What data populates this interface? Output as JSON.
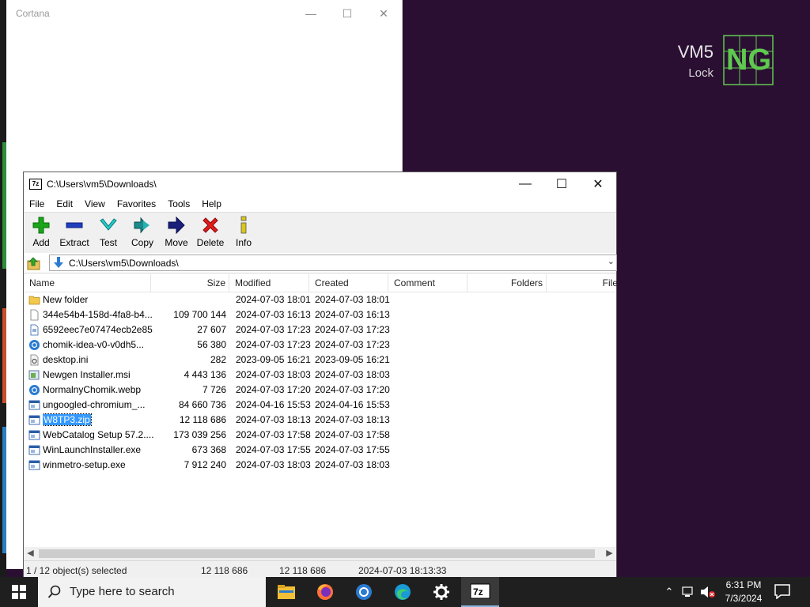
{
  "vm": {
    "name": "VM5",
    "sub": "Lock",
    "logo_text": "NG",
    "accent": "#5fc94f"
  },
  "cortana": {
    "title": "Cortana",
    "controls": {
      "minimize": "—",
      "maximize": "☐",
      "close": "✕"
    }
  },
  "zip": {
    "title": "C:\\Users\\vm5\\Downloads\\",
    "title_icon": "7z",
    "controls": {
      "minimize": "—",
      "maximize": "☐",
      "close": "✕"
    },
    "menu": [
      "File",
      "Edit",
      "View",
      "Favorites",
      "Tools",
      "Help"
    ],
    "toolbar": [
      {
        "label": "Add",
        "icon": "plus-icon"
      },
      {
        "label": "Extract",
        "icon": "minus-icon"
      },
      {
        "label": "Test",
        "icon": "check-icon"
      },
      {
        "label": "Copy",
        "icon": "double-arrow-icon"
      },
      {
        "label": "Move",
        "icon": "arrow-right-icon"
      },
      {
        "label": "Delete",
        "icon": "x-icon"
      },
      {
        "label": "Info",
        "icon": "info-icon"
      }
    ],
    "address": "C:\\Users\\vm5\\Downloads\\",
    "columns": [
      "Name",
      "Size",
      "Modified",
      "Created",
      "Comment",
      "Folders",
      "File"
    ],
    "files": [
      {
        "name": "New folder",
        "size": "",
        "modified": "2024-07-03 18:01",
        "created": "2024-07-03 18:01",
        "icon": "folder-icon"
      },
      {
        "name": "344e54b4-158d-4fa8-b4...",
        "size": "109 700 144",
        "modified": "2024-07-03 16:13",
        "created": "2024-07-03 16:13",
        "icon": "file-icon"
      },
      {
        "name": "6592eec7e07474ecb2e85...",
        "size": "27 607",
        "modified": "2024-07-03 17:23",
        "created": "2024-07-03 17:23",
        "icon": "text-file-icon"
      },
      {
        "name": "chomik-idea-v0-v0dh5...",
        "size": "56 380",
        "modified": "2024-07-03 17:23",
        "created": "2024-07-03 17:23",
        "icon": "chrome-file-icon"
      },
      {
        "name": "desktop.ini",
        "size": "282",
        "modified": "2023-09-05 16:21",
        "created": "2023-09-05 16:21",
        "icon": "settings-file-icon"
      },
      {
        "name": "Newgen Installer.msi",
        "size": "4 443 136",
        "modified": "2024-07-03 18:03",
        "created": "2024-07-03 18:03",
        "icon": "installer-icon"
      },
      {
        "name": "NormalnyChomik.webp",
        "size": "7 726",
        "modified": "2024-07-03 17:20",
        "created": "2024-07-03 17:20",
        "icon": "chrome-file-icon"
      },
      {
        "name": "ungoogled-chromium_...",
        "size": "84 660 736",
        "modified": "2024-04-16 15:53",
        "created": "2024-04-16 15:53",
        "icon": "exe-icon"
      },
      {
        "name": "W8TP3.zip",
        "size": "12 118 686",
        "modified": "2024-07-03 18:13",
        "created": "2024-07-03 18:13",
        "icon": "zip-icon",
        "selected": true
      },
      {
        "name": "WebCatalog Setup 57.2....",
        "size": "173 039 256",
        "modified": "2024-07-03 17:58",
        "created": "2024-07-03 17:58",
        "icon": "exe-icon"
      },
      {
        "name": "WinLaunchInstaller.exe",
        "size": "673 368",
        "modified": "2024-07-03 17:55",
        "created": "2024-07-03 17:55",
        "icon": "exe-icon"
      },
      {
        "name": "winmetro-setup.exe",
        "size": "7 912 240",
        "modified": "2024-07-03 18:03",
        "created": "2024-07-03 18:03",
        "icon": "exe-icon"
      }
    ],
    "status": {
      "selection": "1 / 12 object(s) selected",
      "size": "12 118 686",
      "packed": "12 118 686",
      "date": "2024-07-03 18:13:33"
    }
  },
  "taskbar": {
    "search_placeholder": "Type here to search",
    "apps": [
      "file-explorer-icon",
      "firefox-icon",
      "chrome-icon",
      "edge-icon",
      "settings-icon",
      "7zip-icon"
    ],
    "active_app": "7zip-icon",
    "time": "6:31 PM",
    "date": "7/3/2024"
  }
}
